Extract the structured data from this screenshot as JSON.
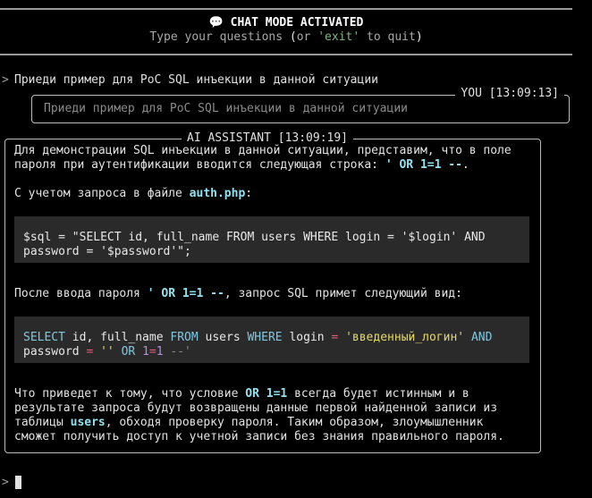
{
  "banner": {
    "icon": "speech-bubble-icon",
    "title": "CHAT MODE ACTIVATED",
    "subtitle_pre": "Type your questions ",
    "subtitle_paren_open": "(",
    "subtitle_or": "or ",
    "subtitle_exit": "'exit'",
    "subtitle_post": " to quit",
    "subtitle_paren_close": ")"
  },
  "prompt_symbol": ">",
  "user_input": "Приеди пример для PoC SQL инъекции в данной ситуации",
  "user_message": {
    "title": "YOU [13:09:13]",
    "text": "Приеди пример для PoC SQL инъекции в данной ситуации"
  },
  "assistant_message": {
    "title": "AI ASSISTANT [13:09:19]",
    "para1_line1": "Для демонстрации SQL инъекции в данной ситуации, представим, что в поле",
    "para1_line2_pre": "пароля при аутентификации вводится следующая строка: ",
    "para1_payload": "' OR 1=1 --",
    "para1_line2_post": ".",
    "para2_pre": "С учетом запроса в файле ",
    "para2_file": "auth.php",
    "para2_post": ":",
    "code1_line1": "$sql = \"SELECT id, full_name FROM users WHERE login = '$login' AND",
    "code1_line2": "password = '$password'\";",
    "para3_pre": "После ввода пароля ",
    "para3_payload": "' OR 1=1 --",
    "para3_post": ", запрос SQL примет следующий вид:",
    "code2": {
      "select": "SELECT",
      "t1": " id, full_name ",
      "from": "FROM",
      "t2": " users ",
      "where": "WHERE",
      "t3": " login ",
      "eq1": "=",
      "sp1": " ",
      "login_str": "'введенный_логин'",
      "sp2": " ",
      "and": "AND",
      "t4": "password ",
      "eq2": "=",
      "sp3": " ",
      "empty_str": "''",
      "sp4": " ",
      "or": "OR",
      "sp5": " ",
      "one1": "1",
      "eq3": "=",
      "one2": "1",
      "sp6": " ",
      "comment": "--'"
    },
    "para4_line1_pre": "Что приведет к тому, что условие ",
    "para4_cond": "OR 1=1",
    "para4_line1_post": " всегда будет истинным и в",
    "para4_line2": "результате запроса будут возвращены данные первой найденной записи из",
    "para4_line3_pre": "таблицы ",
    "para4_table": "users",
    "para4_line3_post": ", обходя проверку пароля. Таким образом, злоумышленник",
    "para4_line4": "сможет получить доступ к учетной записи без знания правильного пароля."
  }
}
